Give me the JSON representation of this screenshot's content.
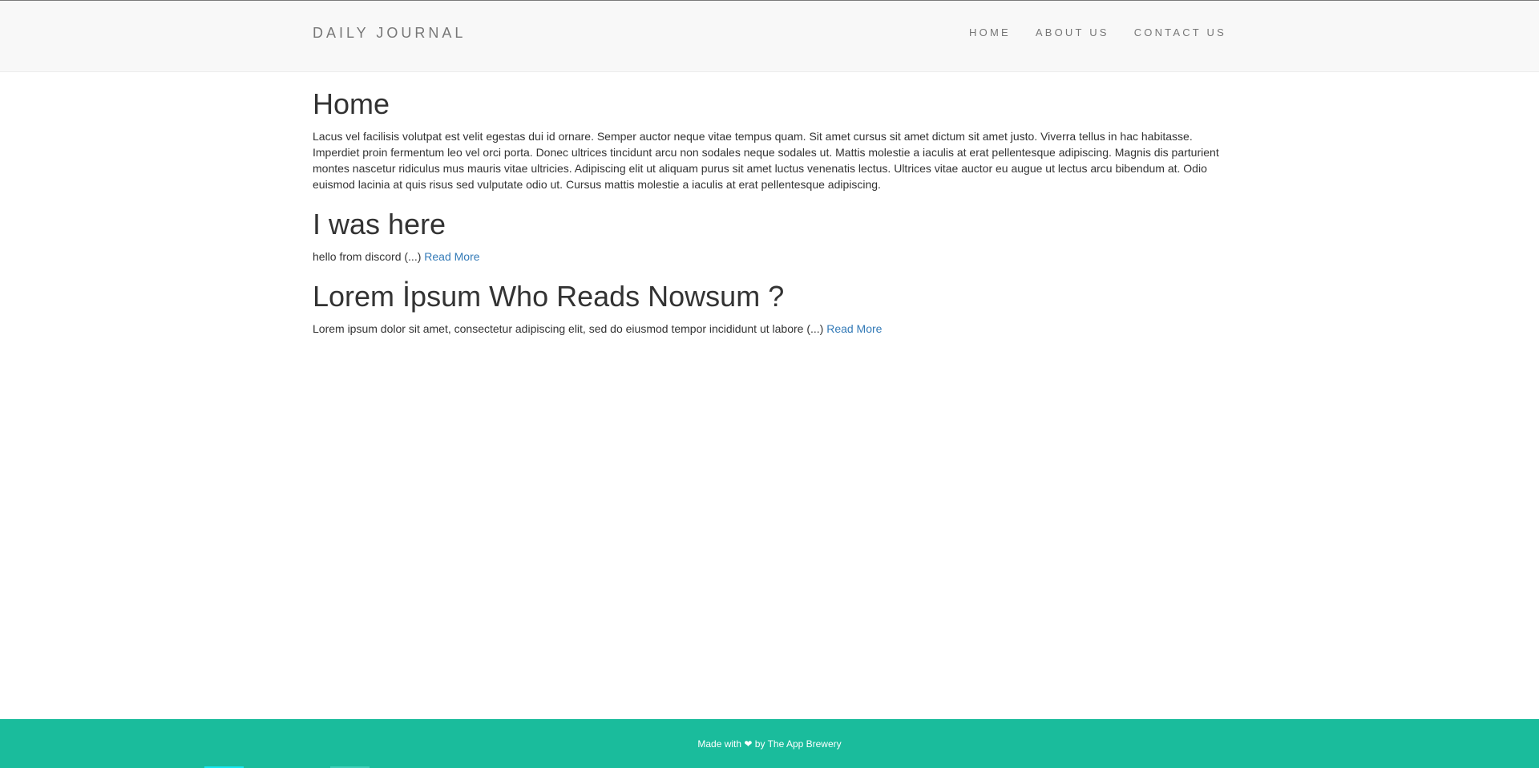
{
  "site": {
    "brand": "DAILY JOURNAL"
  },
  "nav": {
    "items": [
      {
        "label": "HOME"
      },
      {
        "label": "ABOUT US"
      },
      {
        "label": "CONTACT US"
      }
    ]
  },
  "main": {
    "home": {
      "title": "Home",
      "text": "Lacus vel facilisis volutpat est velit egestas dui id ornare. Semper auctor neque vitae tempus quam. Sit amet cursus sit amet dictum sit amet justo. Viverra tellus in hac habitasse. Imperdiet proin fermentum leo vel orci porta. Donec ultrices tincidunt arcu non sodales neque sodales ut. Mattis molestie a iaculis at erat pellentesque adipiscing. Magnis dis parturient montes nascetur ridiculus mus mauris vitae ultricies. Adipiscing elit ut aliquam purus sit amet luctus venenatis lectus. Ultrices vitae auctor eu augue ut lectus arcu bibendum at. Odio euismod lacinia at quis risus sed vulputate odio ut. Cursus mattis molestie a iaculis at erat pellentesque adipiscing."
    },
    "posts": [
      {
        "title": "I was here",
        "excerpt": "hello from discord (...)",
        "link": "Read More"
      },
      {
        "title": "Lorem İpsum Who Reads Nowsum ?",
        "excerpt": "Lorem ipsum dolor sit amet, consectetur adipiscing elit, sed do eiusmod tempor incididunt ut labore (...)",
        "link": "Read More"
      }
    ]
  },
  "footer": {
    "made_with": "Made with",
    "heart_icon": "heart-icon",
    "by": "by The App Brewery"
  },
  "colors": {
    "navbar_bg": "#f8f8f8",
    "link": "#337ab7",
    "footer_bg": "#1abc9c"
  }
}
